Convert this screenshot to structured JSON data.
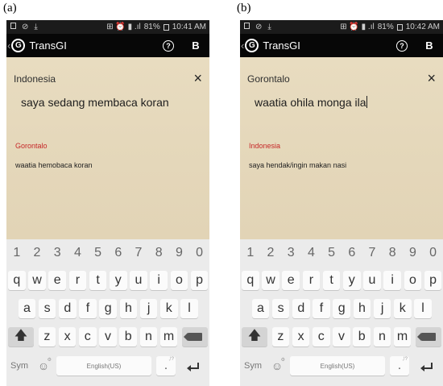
{
  "panels": [
    {
      "label": "(a)",
      "status": {
        "right_icons": "⊞ ⏰ ▮ .ıl",
        "battery": "81%",
        "time": "10:41 AM"
      },
      "appbar": {
        "logo": "G",
        "title": "TransGI",
        "profile": "B"
      },
      "translation": {
        "source_language": "Indonesia",
        "source_text": "saya sedang membaca koran",
        "target_language": "Gorontalo",
        "target_text": "waatia hemobaca koran"
      }
    },
    {
      "label": "(b)",
      "status": {
        "right_icons": "⊞ ⏰ ▮ .ıl",
        "battery": "81%",
        "time": "10:42 AM"
      },
      "appbar": {
        "logo": "G",
        "title": "TransGI",
        "profile": "B"
      },
      "translation": {
        "source_language": "Gorontalo",
        "source_text": "waatia ohila monga ila",
        "target_language": "Indonesia",
        "target_text": "saya hendak/ingin makan nasi"
      }
    }
  ],
  "keyboard": {
    "row_numbers": [
      "1",
      "2",
      "3",
      "4",
      "5",
      "6",
      "7",
      "8",
      "9",
      "0"
    ],
    "row1": [
      "q",
      "w",
      "e",
      "r",
      "t",
      "y",
      "u",
      "i",
      "o",
      "p"
    ],
    "row2": [
      "a",
      "s",
      "d",
      "f",
      "g",
      "h",
      "j",
      "k",
      "l"
    ],
    "row3": [
      "z",
      "x",
      "c",
      "v",
      "b",
      "n",
      "m"
    ],
    "sym_label": "Sym",
    "space_label": "English(US)",
    "period": ".",
    "period_hint": ",!?",
    "emoji_hint": "⚙"
  },
  "icons": {
    "back": "‹",
    "close": "×",
    "help": "?",
    "shift": "🡅",
    "emoji": "☺"
  },
  "colors": {
    "status_bar": "#1b1b1b",
    "app_bar": "#070707",
    "content_bg": "#e5d8bb",
    "target_language": "#c62828",
    "keyboard_bg": "#ebebeb"
  }
}
